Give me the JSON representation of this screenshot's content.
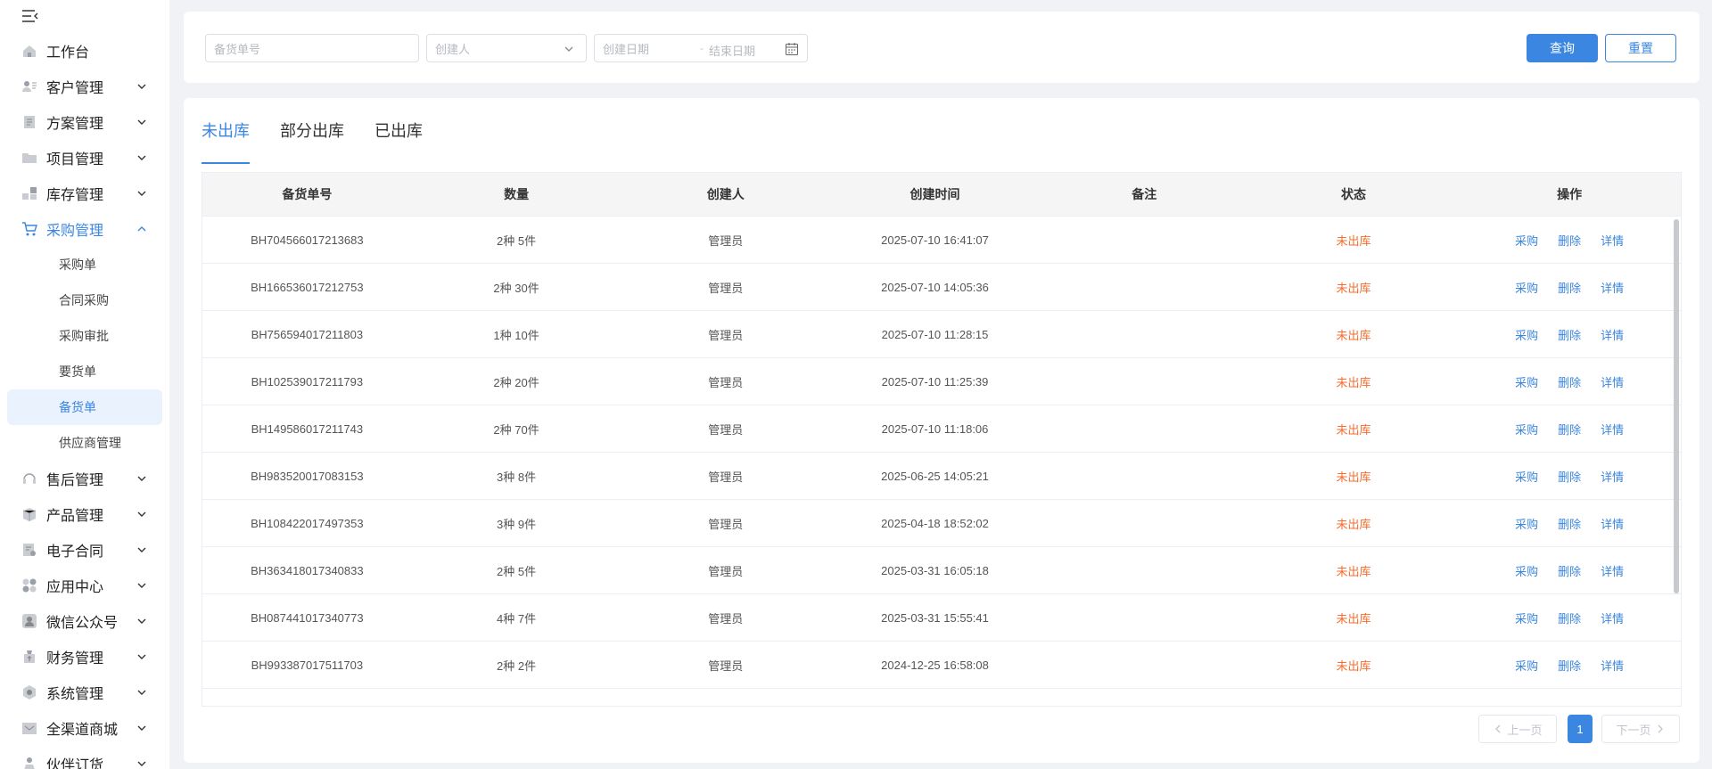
{
  "sidebar": {
    "items": [
      {
        "label": "工作台",
        "icon": "home-icon",
        "has_children": false
      },
      {
        "label": "客户管理",
        "icon": "customer-icon",
        "has_children": true
      },
      {
        "label": "方案管理",
        "icon": "document-icon",
        "has_children": true
      },
      {
        "label": "项目管理",
        "icon": "folder-icon",
        "has_children": true
      },
      {
        "label": "库存管理",
        "icon": "inventory-icon",
        "has_children": true
      },
      {
        "label": "采购管理",
        "icon": "cart-icon",
        "has_children": true,
        "open": true
      },
      {
        "label": "售后管理",
        "icon": "headset-icon",
        "has_children": true
      },
      {
        "label": "产品管理",
        "icon": "box-icon",
        "has_children": true
      },
      {
        "label": "电子合同",
        "icon": "contract-icon",
        "has_children": true
      },
      {
        "label": "应用中心",
        "icon": "apps-icon",
        "has_children": true
      },
      {
        "label": "微信公众号",
        "icon": "wechat-icon",
        "has_children": true
      },
      {
        "label": "财务管理",
        "icon": "finance-icon",
        "has_children": true
      },
      {
        "label": "系统管理",
        "icon": "settings-icon",
        "has_children": true
      },
      {
        "label": "全渠道商城",
        "icon": "mall-icon",
        "has_children": true
      },
      {
        "label": "伙伴订货",
        "icon": "partner-icon",
        "has_children": true
      }
    ],
    "purchase_sub": [
      "采购单",
      "合同采购",
      "采购审批",
      "要货单",
      "备货单",
      "供应商管理"
    ],
    "active_sub": "备货单"
  },
  "search": {
    "order_no_placeholder": "备货单号",
    "creator_placeholder": "创建人",
    "start_date_placeholder": "创建日期",
    "date_separator": "-",
    "end_date_placeholder": "结束日期",
    "query_label": "查询",
    "reset_label": "重置"
  },
  "tabs": [
    "未出库",
    "部分出库",
    "已出库"
  ],
  "active_tab": 0,
  "table": {
    "headers": [
      "备货单号",
      "数量",
      "创建人",
      "创建时间",
      "备注",
      "状态",
      "操作"
    ],
    "rows": [
      {
        "no": "BH704566017213683",
        "qty": "2种 5件",
        "creator": "管理员",
        "time": "2025-07-10 16:41:07",
        "remark": "",
        "status": "未出库"
      },
      {
        "no": "BH166536017212753",
        "qty": "2种 30件",
        "creator": "管理员",
        "time": "2025-07-10 14:05:36",
        "remark": "",
        "status": "未出库"
      },
      {
        "no": "BH756594017211803",
        "qty": "1种 10件",
        "creator": "管理员",
        "time": "2025-07-10 11:28:15",
        "remark": "",
        "status": "未出库"
      },
      {
        "no": "BH102539017211793",
        "qty": "2种 20件",
        "creator": "管理员",
        "time": "2025-07-10 11:25:39",
        "remark": "",
        "status": "未出库"
      },
      {
        "no": "BH149586017211743",
        "qty": "2种 70件",
        "creator": "管理员",
        "time": "2025-07-10 11:18:06",
        "remark": "",
        "status": "未出库"
      },
      {
        "no": "BH983520017083153",
        "qty": "3种 8件",
        "creator": "管理员",
        "time": "2025-06-25 14:05:21",
        "remark": "",
        "status": "未出库"
      },
      {
        "no": "BH108422017497353",
        "qty": "3种 9件",
        "creator": "管理员",
        "time": "2025-04-18 18:52:02",
        "remark": "",
        "status": "未出库"
      },
      {
        "no": "BH363418017340833",
        "qty": "2种 5件",
        "creator": "管理员",
        "time": "2025-03-31 16:05:18",
        "remark": "",
        "status": "未出库"
      },
      {
        "no": "BH087441017340773",
        "qty": "4种 7件",
        "creator": "管理员",
        "time": "2025-03-31 15:55:41",
        "remark": "",
        "status": "未出库"
      },
      {
        "no": "BH993387017511703",
        "qty": "2种 2件",
        "creator": "管理员",
        "time": "2024-12-25 16:58:08",
        "remark": "",
        "status": "未出库"
      }
    ],
    "actions": [
      "采购",
      "删除",
      "详情"
    ]
  },
  "pagination": {
    "prev_label": "上一页",
    "current_page": "1",
    "next_label": "下一页"
  },
  "colors": {
    "accent": "#3a86e0",
    "status_pending": "#f56c2d"
  }
}
